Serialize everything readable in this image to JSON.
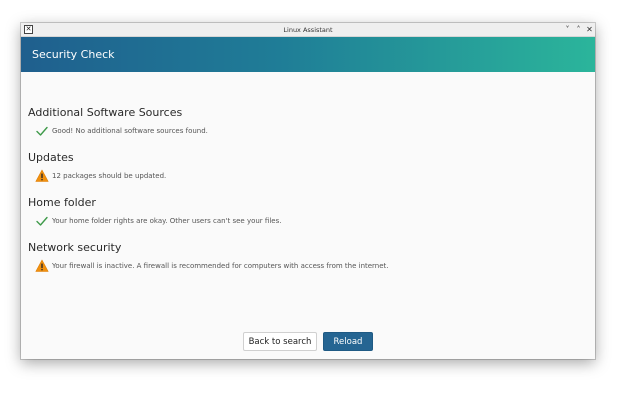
{
  "window": {
    "title": "Linux Assistant",
    "controls": {
      "minimize": "˅",
      "maximize": "˄",
      "close": "✕"
    }
  },
  "header": {
    "title": "Security Check"
  },
  "sections": [
    {
      "title": "Additional Software Sources",
      "status": "ok",
      "message": "Good! No additional software sources found."
    },
    {
      "title": "Updates",
      "status": "warning",
      "message": "12 packages should be updated."
    },
    {
      "title": "Home folder",
      "status": "ok",
      "message": "Your home folder rights are okay. Other users can't see your files."
    },
    {
      "title": "Network security",
      "status": "warning",
      "message": "Your firewall is inactive. A firewall is recommended for computers with access from the internet."
    }
  ],
  "buttons": {
    "back": "Back to search",
    "reload": "Reload"
  },
  "colors": {
    "header_start": "#1f5f8e",
    "header_end": "#2bb59b",
    "ok": "#3f9a4a",
    "warning": "#f0900f",
    "primary_button": "#256592"
  },
  "icons": {
    "ok": "check-icon",
    "warning": "warning-icon",
    "app": "app-icon"
  }
}
